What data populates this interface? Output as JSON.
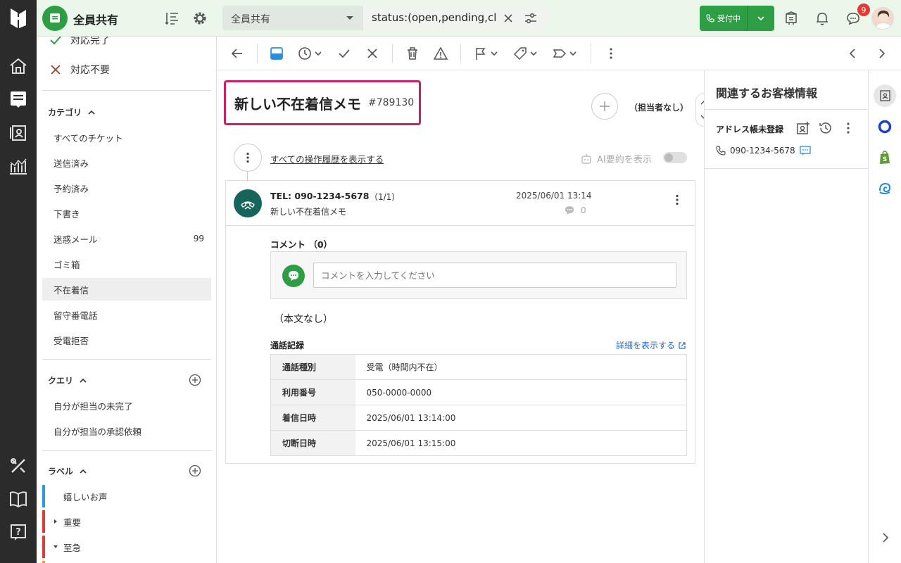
{
  "header": {
    "inbox_title": "全員共有",
    "view_select": "全員共有",
    "filter_text": "status:(open,pending,closed)",
    "status_button": "受付中",
    "notification_count": "9"
  },
  "sidebar": {
    "status_items": [
      {
        "label": "対応完了"
      },
      {
        "label": "対応不要"
      }
    ],
    "category": {
      "title": "カテゴリ",
      "items": [
        {
          "label": "すべてのチケット",
          "count": ""
        },
        {
          "label": "送信済み",
          "count": ""
        },
        {
          "label": "予約済み",
          "count": ""
        },
        {
          "label": "下書き",
          "count": ""
        },
        {
          "label": "迷惑メール",
          "count": "99"
        },
        {
          "label": "ゴミ箱",
          "count": ""
        },
        {
          "label": "不在着信",
          "count": ""
        },
        {
          "label": "留守番電話",
          "count": ""
        },
        {
          "label": "受電拒否",
          "count": ""
        }
      ]
    },
    "query": {
      "title": "クエリ",
      "items": [
        {
          "label": "自分が担当の未完了"
        },
        {
          "label": "自分が担当の承認依頼"
        }
      ]
    },
    "labels": {
      "title": "ラベル",
      "items": [
        {
          "label": "嬉しいお声",
          "color": "#2a9be0"
        },
        {
          "label": "重要",
          "color": "#e53935"
        },
        {
          "label": "至急",
          "color": "#e53935"
        }
      ]
    }
  },
  "ticket": {
    "title": "新しい不在着信メモ",
    "id": "#789130",
    "assignee": "（担当者なし）",
    "history_link": "すべての操作履歴を表示する",
    "ai_summary": "AI要約を表示",
    "message": {
      "tel": "TEL: 090-1234-5678",
      "count": "（1/1）",
      "subject": "新しい不在着信メモ",
      "datetime": "2025/06/01 13:14",
      "comment_count": "0"
    },
    "comments": {
      "title": "コメント （0）",
      "placeholder": "コメントを入力してください"
    },
    "body": "（本文なし）",
    "call_log": {
      "title": "通話記録",
      "detail_link": "詳細を表示する",
      "rows": [
        {
          "key": "通話種別",
          "value": "受電（時間内不在）"
        },
        {
          "key": "利用番号",
          "value": "050-0000-0000"
        },
        {
          "key": "着信日時",
          "value": "2025/06/01 13:14:00"
        },
        {
          "key": "切断日時",
          "value": "2025/06/01 13:15:00"
        }
      ]
    }
  },
  "customer_panel": {
    "title": "関連するお客様情報",
    "name": "アドレス帳未登録",
    "phone": "090-1234-5678"
  },
  "colors": {
    "brand_green": "#2e9e44",
    "highlight": "#cc1f6a",
    "call_icon": "#16655a",
    "link": "#2a6cc4"
  }
}
